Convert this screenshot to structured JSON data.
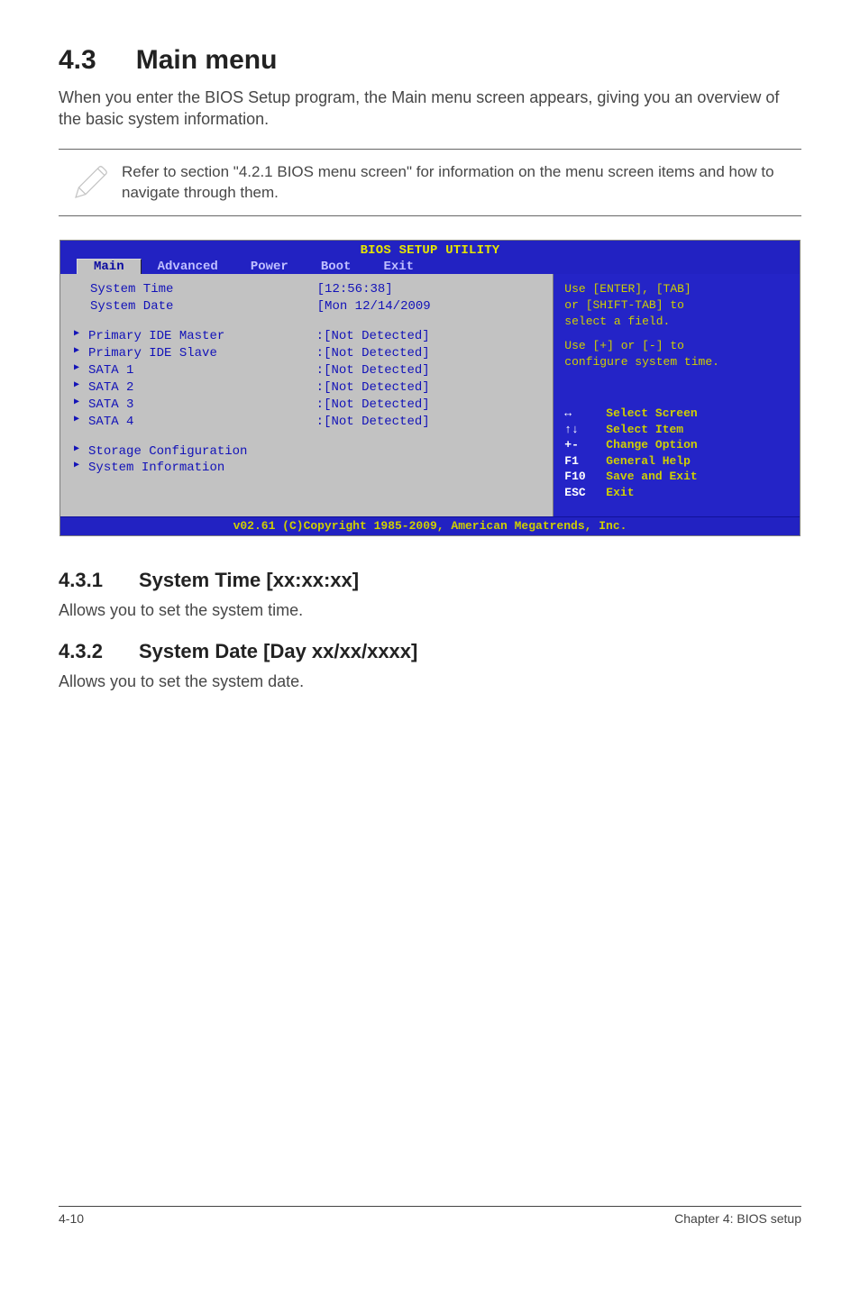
{
  "heading": {
    "num": "4.3",
    "title": "Main menu"
  },
  "intro": "When you enter the BIOS Setup program, the Main menu screen appears, giving you an overview of the basic system information.",
  "note": "Refer to section \"4.2.1  BIOS menu screen\" for information on the menu screen items and how to navigate through them.",
  "bios": {
    "banner": "BIOS SETUP UTILITY",
    "tabs": [
      "Main",
      "Advanced",
      "Power",
      "Boot",
      "Exit"
    ],
    "active_tab_index": 0,
    "left": {
      "system_time_label": "System Time",
      "system_time_value": "[12:56:38]",
      "system_date_label": "System Date",
      "system_date_value": "[Mon 12/14/2009",
      "rows": [
        {
          "label": "Primary IDE Master",
          "value": ":[Not Detected]"
        },
        {
          "label": "Primary IDE Slave",
          "value": ":[Not Detected]"
        },
        {
          "label": "SATA 1",
          "value": ":[Not Detected]"
        },
        {
          "label": "SATA 2",
          "value": ":[Not Detected]"
        },
        {
          "label": "SATA 3",
          "value": ":[Not Detected]"
        },
        {
          "label": "SATA 4",
          "value": ":[Not Detected]"
        }
      ],
      "extra": [
        "Storage Configuration",
        "System Information"
      ]
    },
    "right": {
      "help1": "Use [ENTER], [TAB]\nor [SHIFT-TAB] to\nselect a field.",
      "help2": "Use [+] or [-] to\nconfigure system time.",
      "keys": [
        {
          "k": "↔",
          "d": "Select Screen"
        },
        {
          "k": "↑↓",
          "d": "Select Item"
        },
        {
          "k": "+-",
          "d": "Change Option"
        },
        {
          "k": "F1",
          "d": "General Help"
        },
        {
          "k": "F10",
          "d": "Save and Exit"
        },
        {
          "k": "ESC",
          "d": "Exit"
        }
      ]
    },
    "footer": "v02.61 (C)Copyright 1985-2009, American Megatrends, Inc."
  },
  "sub1": {
    "num": "4.3.1",
    "title": "System Time [xx:xx:xx]",
    "body": "Allows you to set the system time."
  },
  "sub2": {
    "num": "4.3.2",
    "title": "System Date [Day xx/xx/xxxx]",
    "body": "Allows you to set the system date."
  },
  "footer": {
    "left": "4-10",
    "right": "Chapter 4: BIOS setup"
  }
}
